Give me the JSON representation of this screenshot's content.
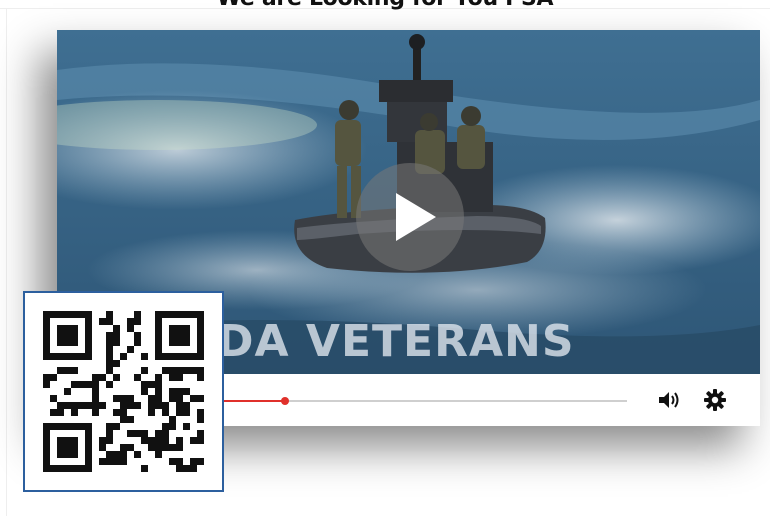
{
  "page": {
    "title": "We are Looking for You PSA"
  },
  "video": {
    "overlay_text": "DA VETERANS",
    "progress_fraction": 0.33,
    "colors": {
      "accent": "#e0302b",
      "water": "#4d7ea0",
      "qr_border": "#2c5f9e"
    }
  },
  "controls": {
    "play_icon": "play-icon",
    "volume_icon": "volume-icon",
    "settings_icon": "gear-icon"
  },
  "qr": {
    "icon": "qr-code-icon"
  }
}
